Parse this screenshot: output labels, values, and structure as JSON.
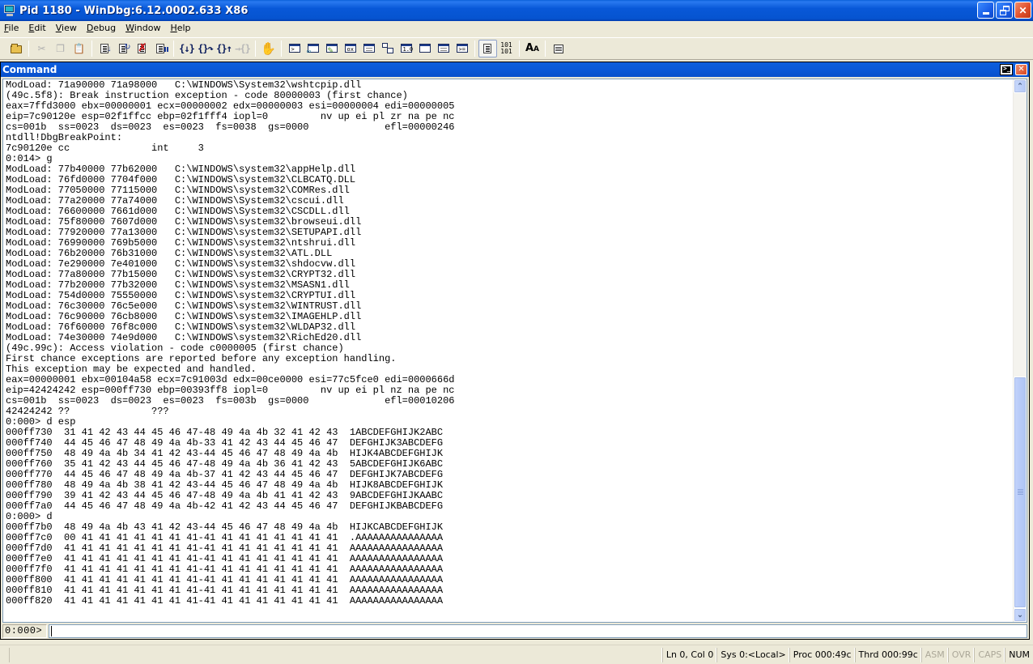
{
  "window": {
    "title": "Pid 1180 - WinDbg:6.12.0002.633 X86",
    "icon": "windbg-app-icon",
    "controls": [
      "minimize",
      "restore",
      "close"
    ]
  },
  "menu": [
    {
      "label": "File",
      "accel": "F"
    },
    {
      "label": "Edit",
      "accel": "E"
    },
    {
      "label": "View",
      "accel": "V"
    },
    {
      "label": "Debug",
      "accel": "D"
    },
    {
      "label": "Window",
      "accel": "W"
    },
    {
      "label": "Help",
      "accel": "H"
    }
  ],
  "toolbar": {
    "groups": [
      [
        {
          "name": "open-executable",
          "icon": "open-folder-icon",
          "enabled": true
        }
      ],
      [
        {
          "name": "cut",
          "icon": "cut-icon",
          "enabled": false
        },
        {
          "name": "copy",
          "icon": "copy-icon",
          "enabled": false
        },
        {
          "name": "paste",
          "icon": "paste-icon",
          "enabled": true
        }
      ],
      [
        {
          "name": "go",
          "icon": "go-icon",
          "enabled": true
        },
        {
          "name": "restart",
          "icon": "restart-icon",
          "enabled": true
        },
        {
          "name": "stop-debugging",
          "icon": "stop-debugging-icon",
          "enabled": true
        },
        {
          "name": "break",
          "icon": "break-icon",
          "enabled": true
        }
      ],
      [
        {
          "name": "step-into",
          "icon": "step-into-icon",
          "enabled": true
        },
        {
          "name": "step-over",
          "icon": "step-over-icon",
          "enabled": true
        },
        {
          "name": "step-out",
          "icon": "step-out-icon",
          "enabled": true
        },
        {
          "name": "run-to-cursor",
          "icon": "run-to-cursor-icon",
          "enabled": false
        }
      ],
      [
        {
          "name": "insert-breakpoint",
          "icon": "hand-icon",
          "enabled": true
        }
      ],
      [
        {
          "name": "command-window",
          "icon": "command-window-icon",
          "enabled": true
        },
        {
          "name": "watch-window",
          "icon": "watch-icon",
          "enabled": true
        },
        {
          "name": "locals-window",
          "icon": "locals-icon",
          "enabled": true
        },
        {
          "name": "registers-window",
          "icon": "registers-icon",
          "enabled": true
        },
        {
          "name": "memory-window",
          "icon": "memory-icon",
          "enabled": true
        },
        {
          "name": "call-stack-window",
          "icon": "call-stack-icon",
          "enabled": true
        },
        {
          "name": "disassembly-window",
          "icon": "disassembly-icon",
          "enabled": true
        },
        {
          "name": "scratch-pad-window",
          "icon": "scratch-pad-icon",
          "enabled": true
        },
        {
          "name": "processes-threads-window",
          "icon": "processes-threads-icon",
          "enabled": true
        },
        {
          "name": "command-browser-window",
          "icon": "command-browser-icon",
          "enabled": true
        }
      ],
      [
        {
          "name": "source-mode",
          "icon": "source-mode-icon",
          "enabled": true,
          "pressed": true
        },
        {
          "name": "binary-mode",
          "icon": "binary-mode-icon",
          "enabled": true
        }
      ],
      [
        {
          "name": "font",
          "icon": "font-icon",
          "enabled": true
        }
      ],
      [
        {
          "name": "options",
          "icon": "options-icon",
          "enabled": true
        }
      ]
    ],
    "binary_glyph": "101\n101",
    "font_glyph_big": "A",
    "font_glyph_small": "A",
    "box_glyphs": {
      "locals": "ox",
      "disassembly": "1.0"
    }
  },
  "command_window": {
    "title": "Command",
    "output_lines": [
      "ModLoad: 71a90000 71a98000   C:\\WINDOWS\\System32\\wshtcpip.dll",
      "(49c.5f8): Break instruction exception - code 80000003 (first chance)",
      "eax=7ffd3000 ebx=00000001 ecx=00000002 edx=00000003 esi=00000004 edi=00000005",
      "eip=7c90120e esp=02f1ffcc ebp=02f1fff4 iopl=0         nv up ei pl zr na pe nc",
      "cs=001b  ss=0023  ds=0023  es=0023  fs=0038  gs=0000             efl=00000246",
      "ntdll!DbgBreakPoint:",
      "7c90120e cc              int     3",
      "0:014> g",
      "ModLoad: 77b40000 77b62000   C:\\WINDOWS\\system32\\appHelp.dll",
      "ModLoad: 76fd0000 7704f000   C:\\WINDOWS\\system32\\CLBCATQ.DLL",
      "ModLoad: 77050000 77115000   C:\\WINDOWS\\system32\\COMRes.dll",
      "ModLoad: 77a20000 77a74000   C:\\WINDOWS\\System32\\cscui.dll",
      "ModLoad: 76600000 7661d000   C:\\WINDOWS\\System32\\CSCDLL.dll",
      "ModLoad: 75f80000 7607d000   C:\\WINDOWS\\system32\\browseui.dll",
      "ModLoad: 77920000 77a13000   C:\\WINDOWS\\system32\\SETUPAPI.dll",
      "ModLoad: 76990000 769b5000   C:\\WINDOWS\\system32\\ntshrui.dll",
      "ModLoad: 76b20000 76b31000   C:\\WINDOWS\\system32\\ATL.DLL",
      "ModLoad: 7e290000 7e401000   C:\\WINDOWS\\system32\\shdocvw.dll",
      "ModLoad: 77a80000 77b15000   C:\\WINDOWS\\system32\\CRYPT32.dll",
      "ModLoad: 77b20000 77b32000   C:\\WINDOWS\\system32\\MSASN1.dll",
      "ModLoad: 754d0000 75550000   C:\\WINDOWS\\system32\\CRYPTUI.dll",
      "ModLoad: 76c30000 76c5e000   C:\\WINDOWS\\system32\\WINTRUST.dll",
      "ModLoad: 76c90000 76cb8000   C:\\WINDOWS\\system32\\IMAGEHLP.dll",
      "ModLoad: 76f60000 76f8c000   C:\\WINDOWS\\system32\\WLDAP32.dll",
      "ModLoad: 74e30000 74e9d000   C:\\WINDOWS\\system32\\RichEd20.dll",
      "(49c.99c): Access violation - code c0000005 (first chance)",
      "First chance exceptions are reported before any exception handling.",
      "This exception may be expected and handled.",
      "eax=00000001 ebx=00104a58 ecx=7c91003d edx=00ce0000 esi=77c5fce0 edi=0000666d",
      "eip=42424242 esp=000ff730 ebp=00393ff8 iopl=0         nv up ei pl nz na pe nc",
      "cs=001b  ss=0023  ds=0023  es=0023  fs=003b  gs=0000             efl=00010206",
      "42424242 ??              ???",
      "0:000> d esp",
      "000ff730  31 41 42 43 44 45 46 47-48 49 4a 4b 32 41 42 43  1ABCDEFGHIJK2ABC",
      "000ff740  44 45 46 47 48 49 4a 4b-33 41 42 43 44 45 46 47  DEFGHIJK3ABCDEFG",
      "000ff750  48 49 4a 4b 34 41 42 43-44 45 46 47 48 49 4a 4b  HIJK4ABCDEFGHIJK",
      "000ff760  35 41 42 43 44 45 46 47-48 49 4a 4b 36 41 42 43  5ABCDEFGHIJK6ABC",
      "000ff770  44 45 46 47 48 49 4a 4b-37 41 42 43 44 45 46 47  DEFGHIJK7ABCDEFG",
      "000ff780  48 49 4a 4b 38 41 42 43-44 45 46 47 48 49 4a 4b  HIJK8ABCDEFGHIJK",
      "000ff790  39 41 42 43 44 45 46 47-48 49 4a 4b 41 41 42 43  9ABCDEFGHIJKAABC",
      "000ff7a0  44 45 46 47 48 49 4a 4b-42 41 42 43 44 45 46 47  DEFGHIJKBABCDEFG",
      "0:000> d",
      "000ff7b0  48 49 4a 4b 43 41 42 43-44 45 46 47 48 49 4a 4b  HIJKCABCDEFGHIJK",
      "000ff7c0  00 41 41 41 41 41 41 41-41 41 41 41 41 41 41 41  .AAAAAAAAAAAAAAA",
      "000ff7d0  41 41 41 41 41 41 41 41-41 41 41 41 41 41 41 41  AAAAAAAAAAAAAAAA",
      "000ff7e0  41 41 41 41 41 41 41 41-41 41 41 41 41 41 41 41  AAAAAAAAAAAAAAAA",
      "000ff7f0  41 41 41 41 41 41 41 41-41 41 41 41 41 41 41 41  AAAAAAAAAAAAAAAA",
      "000ff800  41 41 41 41 41 41 41 41-41 41 41 41 41 41 41 41  AAAAAAAAAAAAAAAA",
      "000ff810  41 41 41 41 41 41 41 41-41 41 41 41 41 41 41 41  AAAAAAAAAAAAAAAA",
      "000ff820  41 41 41 41 41 41 41 41-41 41 41 41 41 41 41 41  AAAAAAAAAAAAAAAA"
    ],
    "scroll": {
      "thumb_start_fraction": 0.55,
      "thumb_end_fraction": 1.0
    },
    "prompt": "0:000>",
    "input_value": ""
  },
  "statusbar": {
    "panes": [
      {
        "name": "line-col",
        "text": "Ln 0, Col 0",
        "enabled": true
      },
      {
        "name": "system",
        "text": "Sys 0:<Local>",
        "enabled": true
      },
      {
        "name": "process",
        "text": "Proc 000:49c",
        "enabled": true
      },
      {
        "name": "thread",
        "text": "Thrd 000:99c",
        "enabled": true
      },
      {
        "name": "asm",
        "text": "ASM",
        "enabled": false
      },
      {
        "name": "ovr",
        "text": "OVR",
        "enabled": false
      },
      {
        "name": "caps",
        "text": "CAPS",
        "enabled": false
      },
      {
        "name": "num",
        "text": "NUM",
        "enabled": true
      }
    ]
  }
}
